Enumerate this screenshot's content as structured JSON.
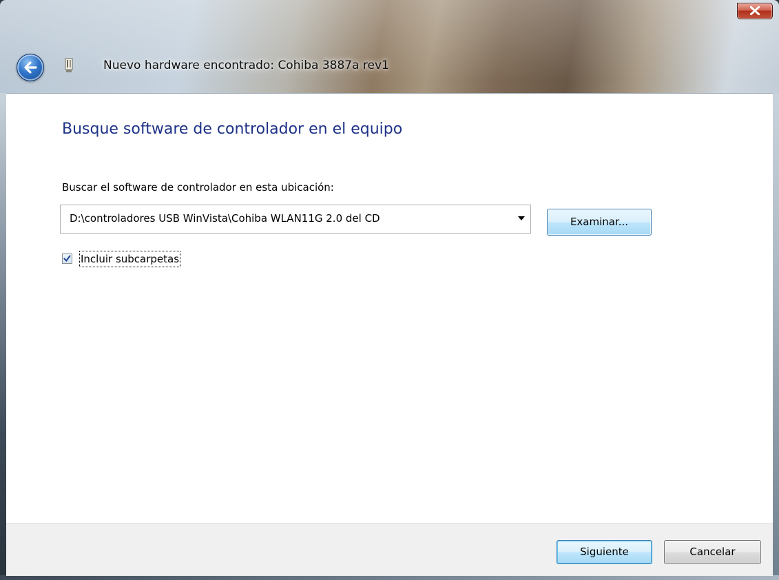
{
  "window": {
    "title": "Nuevo hardware encontrado: Cohiba 3887a rev1",
    "close_icon": "close-icon",
    "back_icon": "back-arrow-icon",
    "hardware_icon": "usb-device-icon"
  },
  "page": {
    "heading": "Busque software de controlador en el equipo",
    "location_label": "Buscar el software de controlador en esta ubicación:",
    "path_value": "D:\\controladores USB WinVista\\Cohiba WLAN11G 2.0 del CD",
    "browse_label": "Examinar...",
    "include_subfolders_label": "Incluir subcarpetas",
    "include_subfolders_checked": true
  },
  "footer": {
    "next_label": "Siguiente",
    "cancel_label": "Cancelar"
  },
  "colors": {
    "heading": "#1e3287",
    "accent_button": "#a7d9f5",
    "close_button": "#c2533d"
  }
}
